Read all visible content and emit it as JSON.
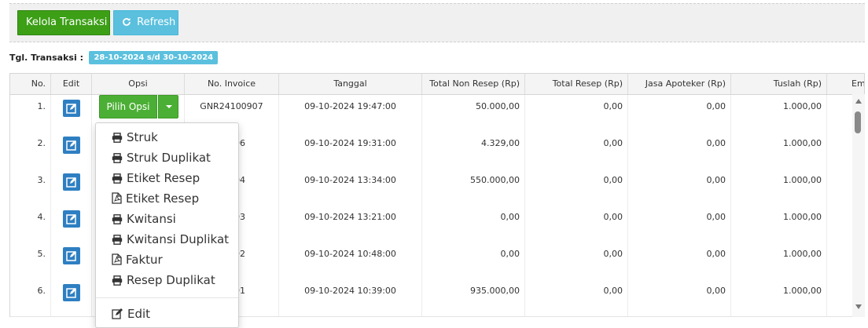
{
  "toolbar": {
    "kelola_label": "Kelola Transaksi",
    "refresh_label": "Refresh"
  },
  "filter": {
    "label": "Tgl. Transaksi :",
    "range": "28-10-2024 s/d 30-10-2024"
  },
  "table": {
    "headers": {
      "no": "No.",
      "edit": "Edit",
      "opsi": "Opsi",
      "invoice": "No. Invoice",
      "tanggal": "Tanggal",
      "non_resep": "Total Non Resep (Rp)",
      "resep": "Total Resep (Rp)",
      "jasa": "Jasa Apoteker (Rp)",
      "tuslah": "Tuslah (Rp)",
      "em": "Em"
    },
    "pilih_opsi_label": "Pilih Opsi",
    "rows": [
      {
        "no": "1.",
        "invoice": "GNR24100907",
        "tanggal": "09-10-2024 19:47:00",
        "non_resep": "50.000,00",
        "resep": "0,00",
        "jasa": "0,00",
        "tuslah": "1.000,00"
      },
      {
        "no": "2.",
        "invoice": "00906",
        "tanggal": "09-10-2024 19:31:00",
        "non_resep": "4.329,00",
        "resep": "0,00",
        "jasa": "0,00",
        "tuslah": "1.000,00"
      },
      {
        "no": "3.",
        "invoice": "00904",
        "tanggal": "09-10-2024 13:34:00",
        "non_resep": "550.000,00",
        "resep": "0,00",
        "jasa": "0,00",
        "tuslah": "1.000,00"
      },
      {
        "no": "4.",
        "invoice": "00903",
        "tanggal": "09-10-2024 13:21:00",
        "non_resep": "0,00",
        "resep": "0,00",
        "jasa": "0,00",
        "tuslah": "1.000,00"
      },
      {
        "no": "5.",
        "invoice": "00902",
        "tanggal": "09-10-2024 10:48:00",
        "non_resep": "0,00",
        "resep": "0,00",
        "jasa": "0,00",
        "tuslah": "1.000,00"
      },
      {
        "no": "6.",
        "invoice": "00901",
        "tanggal": "09-10-2024 10:39:00",
        "non_resep": "935.000,00",
        "resep": "0,00",
        "jasa": "0,00",
        "tuslah": "1.000,00"
      }
    ]
  },
  "dropdown": {
    "items": [
      {
        "label": "Struk",
        "icon": "print-icon"
      },
      {
        "label": "Struk Duplikat",
        "icon": "print-icon"
      },
      {
        "label": "Etiket Resep",
        "icon": "print-icon"
      },
      {
        "label": "Etiket Resep",
        "icon": "pdf-file-icon"
      },
      {
        "label": "Kwitansi",
        "icon": "print-icon"
      },
      {
        "label": "Kwitansi Duplikat",
        "icon": "print-icon"
      },
      {
        "label": "Faktur",
        "icon": "pdf-file-icon"
      },
      {
        "label": "Resep Duplikat",
        "icon": "print-icon"
      },
      {
        "label": "Edit",
        "icon": "edit-icon"
      }
    ]
  },
  "colors": {
    "primary_green": "#3c9f16",
    "info_cyan": "#5bc0de",
    "edit_blue": "#2e7fc2"
  }
}
